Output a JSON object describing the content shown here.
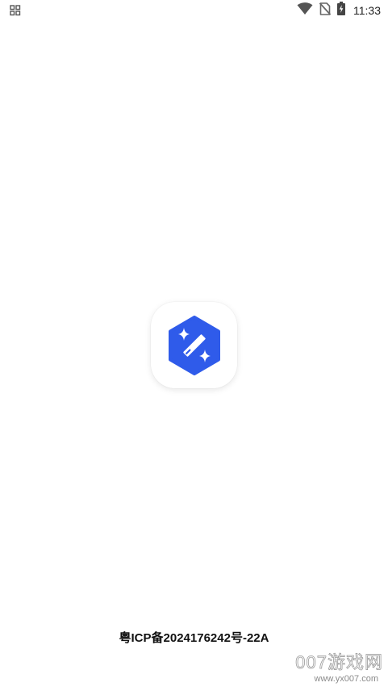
{
  "status_bar": {
    "time": "11:33",
    "left_icon": "notification-grid-icon",
    "right_icons": [
      "wifi-icon",
      "no-sim-icon",
      "battery-charging-icon"
    ]
  },
  "app_logo": {
    "icon": "magic-wand-sparkle-icon",
    "brand_color": "#2F5BEA"
  },
  "footer": {
    "icp_text": "粤ICP备2024176242号-22A"
  },
  "watermark": {
    "main": "007游戏网",
    "url": "www.yx007.com"
  }
}
